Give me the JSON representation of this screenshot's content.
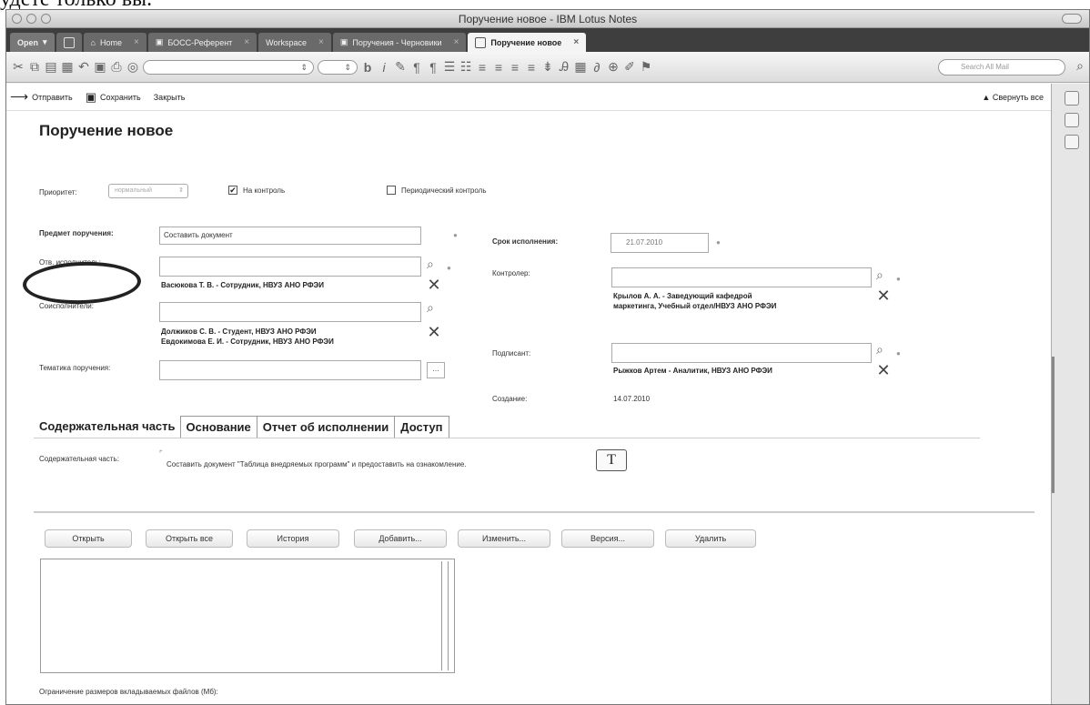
{
  "page_top_text": "удете только вы.",
  "window": {
    "title": "Поручение новое - IBM Lotus Notes"
  },
  "tabs": [
    {
      "label": "Open",
      "kind": "open"
    },
    {
      "label": "Home"
    },
    {
      "label": "БОСС-Референт"
    },
    {
      "label": "Workspace"
    },
    {
      "label": "Поручения - Черновики"
    },
    {
      "label": "Поручение новое",
      "kind": "active"
    }
  ],
  "toolbar": {
    "search_placeholder": "Search All Mail"
  },
  "actions": {
    "send": "Отправить",
    "save": "Сохранить",
    "close": "Закрыть",
    "collapse_all": "▲ Свернуть все"
  },
  "form": {
    "title": "Поручение новое",
    "priority_label": "Приоритет:",
    "priority_value": "нормальный",
    "on_control_label": "На контроль",
    "periodic_control_label": "Периодический контроль",
    "subject_label": "Предмет поручения:",
    "subject_value": "Составить документ",
    "responsible_label": "Отв. исполнитель:",
    "responsible_value": "Васюкова Т. В. - Сотрудник, НВУЗ АНО РФЭИ",
    "coexecutors_label": "Соисполнители:",
    "coexecutors_values": [
      "Должиков С. В. - Студент, НВУЗ АНО РФЭИ",
      "Евдокимова Е. И. - Сотрудник, НВУЗ АНО РФЭИ"
    ],
    "topic_label": "Тематика поручения:",
    "deadline_label": "Срок исполнения:",
    "deadline_value": "21.07.2010",
    "controller_label": "Контролер:",
    "controller_value": [
      "Крылов А. А. - Заведующий кафедрой",
      "маркетинга, Учебный отдел/НВУЗ АНО РФЭИ"
    ],
    "signer_label": "Подписант:",
    "signer_value": "Рыжков Артем - Аналитик, НВУЗ АНО РФЭИ",
    "created_label": "Создание:",
    "created_value": "14.07.2010"
  },
  "doc_tabs": [
    "Содержательная часть",
    "Основание",
    "Отчет об исполнении",
    "Доступ"
  ],
  "content": {
    "label": "Содержательная часть:",
    "text": "Составить документ \"Таблица внедряемых программ\" и предоставить на ознакомление.",
    "t_button": "T"
  },
  "buttons": [
    "Открыть",
    "Открыть все",
    "История",
    "Добавить...",
    "Изменить...",
    "Версия...",
    "Удалить"
  ],
  "attachments_limit_label": "Ограничение размеров вкладываемых файлов (Мб):"
}
